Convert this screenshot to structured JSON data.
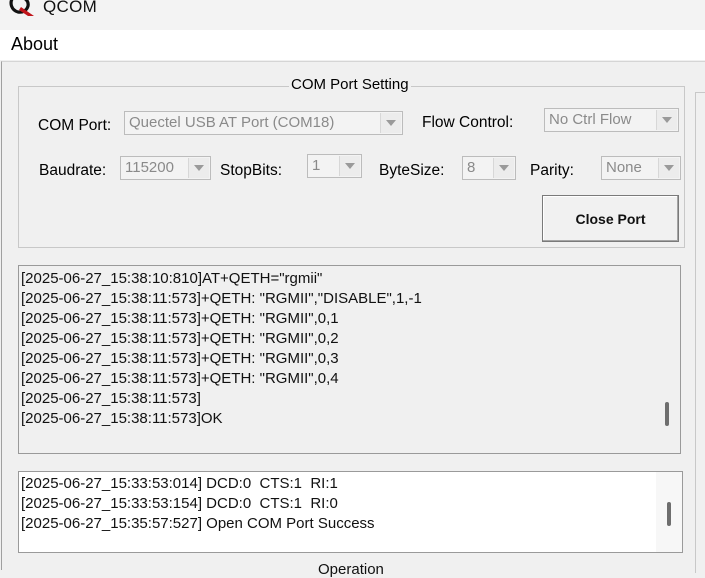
{
  "window": {
    "title": "QCOM"
  },
  "menu": {
    "about": "About"
  },
  "com_settings": {
    "group_title": "COM Port Setting",
    "com_port_label": "COM Port:",
    "com_port_value": "Quectel USB AT Port (COM18)",
    "flow_control_label": "Flow Control:",
    "flow_control_value": "No Ctrl Flow",
    "baudrate_label": "Baudrate:",
    "baudrate_value": "115200",
    "stopbits_label": "StopBits:",
    "stopbits_value": "1",
    "bytesize_label": "ByteSize:",
    "bytesize_value": "8",
    "parity_label": "Parity:",
    "parity_value": "None",
    "close_port_button": "Close Port"
  },
  "log": {
    "lines": [
      "[2025-06-27_15:38:10:810]AT+QETH=\"rgmii\"",
      "[2025-06-27_15:38:11:573]+QETH: \"RGMII\",\"DISABLE\",1,-1",
      "[2025-06-27_15:38:11:573]+QETH: \"RGMII\",0,1",
      "[2025-06-27_15:38:11:573]+QETH: \"RGMII\",0,2",
      "[2025-06-27_15:38:11:573]+QETH: \"RGMII\",0,3",
      "[2025-06-27_15:38:11:573]+QETH: \"RGMII\",0,4",
      "[2025-06-27_15:38:11:573]",
      "[2025-06-27_15:38:11:573]OK"
    ]
  },
  "status": {
    "lines": [
      "[2025-06-27_15:33:53:014] DCD:0  CTS:1  RI:1",
      "[2025-06-27_15:33:53:154] DCD:0  CTS:1  RI:0",
      "[2025-06-27_15:35:57:527] Open COM Port Success"
    ]
  },
  "operation": {
    "group_title": "Operation"
  },
  "colors": {
    "disabled_text": "#8a8a8a",
    "panel_bg": "#f0f0f0",
    "scroll_thumb": "#6e6e6e"
  },
  "icons": {
    "logo": "qcom-logo-icon",
    "dropdown": "chevron-down-icon"
  }
}
